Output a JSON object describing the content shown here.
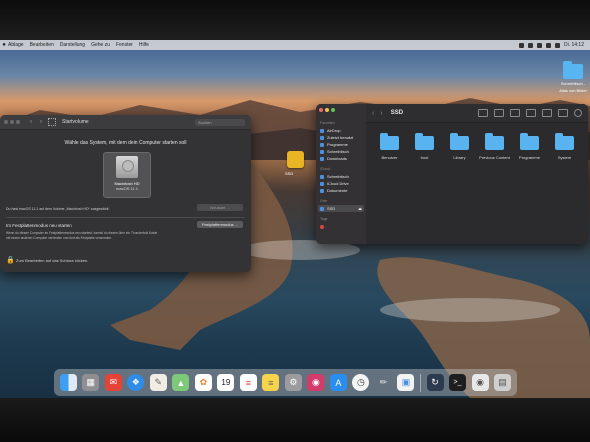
{
  "menubar": {
    "apple": "",
    "items": [
      "Ablage",
      "Bearbeiten",
      "Darstellung",
      "Gehe zu",
      "Fenster",
      "Hilfe"
    ],
    "clock": "Di. 14:12"
  },
  "desktop": {
    "icon_label_1": "Schreibtisch -",
    "icon_label_2": "Alias von Bilder",
    "drive_label": "SSD"
  },
  "startup_disk": {
    "title": "Startvolume",
    "search_placeholder": "Suchen",
    "heading": "Wähle das System, mit dem dein Computer starten soll",
    "disk_name": "Macintosh HD",
    "disk_os": "macOS 11.1",
    "status": "Du hast macOS 11.1 auf dem Volume „Macintosh HD“ ausgewählt.",
    "restart_button": "Neustart ...",
    "target_title": "Im Festplattenmodus neu starten",
    "target_button": "Festplattenmodus ...",
    "target_desc_1": "Wenn du diesen Computer im Festplattenmodus neu startest, kannst du diesen über ein Thunderbolt-Kabel",
    "target_desc_2": "mit einem anderen Computer verbinden und dort als Festplatte verwenden.",
    "lock_text": "Zum Bearbeiten auf das Schloss klicken."
  },
  "finder": {
    "title": "SSD",
    "sections": {
      "favorites": "Favoriten",
      "icloud": "iCloud",
      "locations": "Orte",
      "tags": "Tags"
    },
    "favorites": [
      "AirDrop",
      "Zuletzt benutzt",
      "Programme",
      "Schreibtisch",
      "Downloads"
    ],
    "icloud_items": [
      "Schreibtisch",
      "iCloud Drive",
      "Dokumente"
    ],
    "locations": [
      "SSD"
    ],
    "files": [
      "Benutzer",
      "boot",
      "Library",
      "Previous Content",
      "Programme",
      "System"
    ]
  },
  "dock": {
    "apps": [
      "finder-icon",
      "launchpad-icon",
      "mail-icon",
      "safari-icon",
      "textedit-icon",
      "maps-icon",
      "photos-icon",
      "calendar-icon",
      "reminders-icon",
      "notes-icon",
      "settings-icon",
      "game-icon",
      "appstore-icon",
      "clock-icon",
      "pencil-icon",
      "preview-icon",
      "activity-icon",
      "terminal-icon",
      "disk-utility-icon",
      "trash-icon"
    ],
    "calendar_day": "19"
  },
  "colors": {
    "folder": "#58b3f0",
    "accent_close": "#ed6a5e",
    "accent_min": "#f5bf4f",
    "accent_max": "#61c554"
  }
}
